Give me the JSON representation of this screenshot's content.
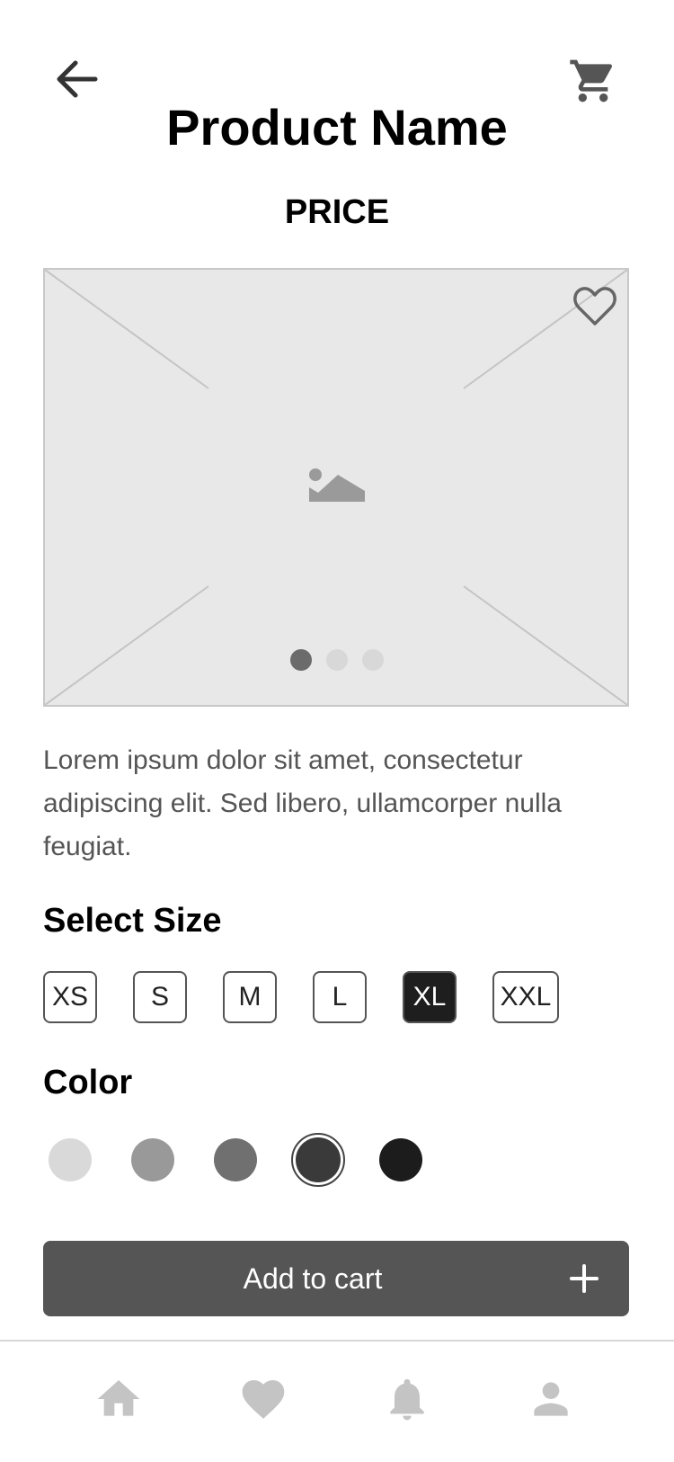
{
  "header": {
    "title": "Product Name",
    "price": "PRICE",
    "icons": {
      "back": "arrow-left-icon",
      "cart": "shopping-cart-icon"
    }
  },
  "image": {
    "placeholder_icon": "image-icon",
    "favorite_icon": "heart-outline-icon",
    "carousel": {
      "total": 3,
      "active_index": 0
    }
  },
  "description": "Lorem ipsum dolor sit amet, consectetur adipiscing elit. Sed libero, ullamcorper nulla feugiat.",
  "size": {
    "title": "Select Size",
    "options": [
      "XS",
      "S",
      "M",
      "L",
      "XL",
      "XXL"
    ],
    "selected": "XL"
  },
  "color": {
    "title": "Color",
    "options": [
      "#d9d9d9",
      "#999999",
      "#707070",
      "#3a3a3a",
      "#1c1c1c"
    ],
    "selected_index": 3
  },
  "cta": {
    "label": "Add to cart",
    "icon": "plus-icon"
  },
  "bottom_nav": {
    "items": [
      {
        "icon": "home-icon"
      },
      {
        "icon": "heart-icon"
      },
      {
        "icon": "bell-icon"
      },
      {
        "icon": "user-icon"
      }
    ]
  },
  "colors": {
    "primary": "#555555",
    "selected_chip": "#1e1e1e",
    "placeholder_bg": "#e8e8e8",
    "muted_icon": "#c4c4c4"
  }
}
